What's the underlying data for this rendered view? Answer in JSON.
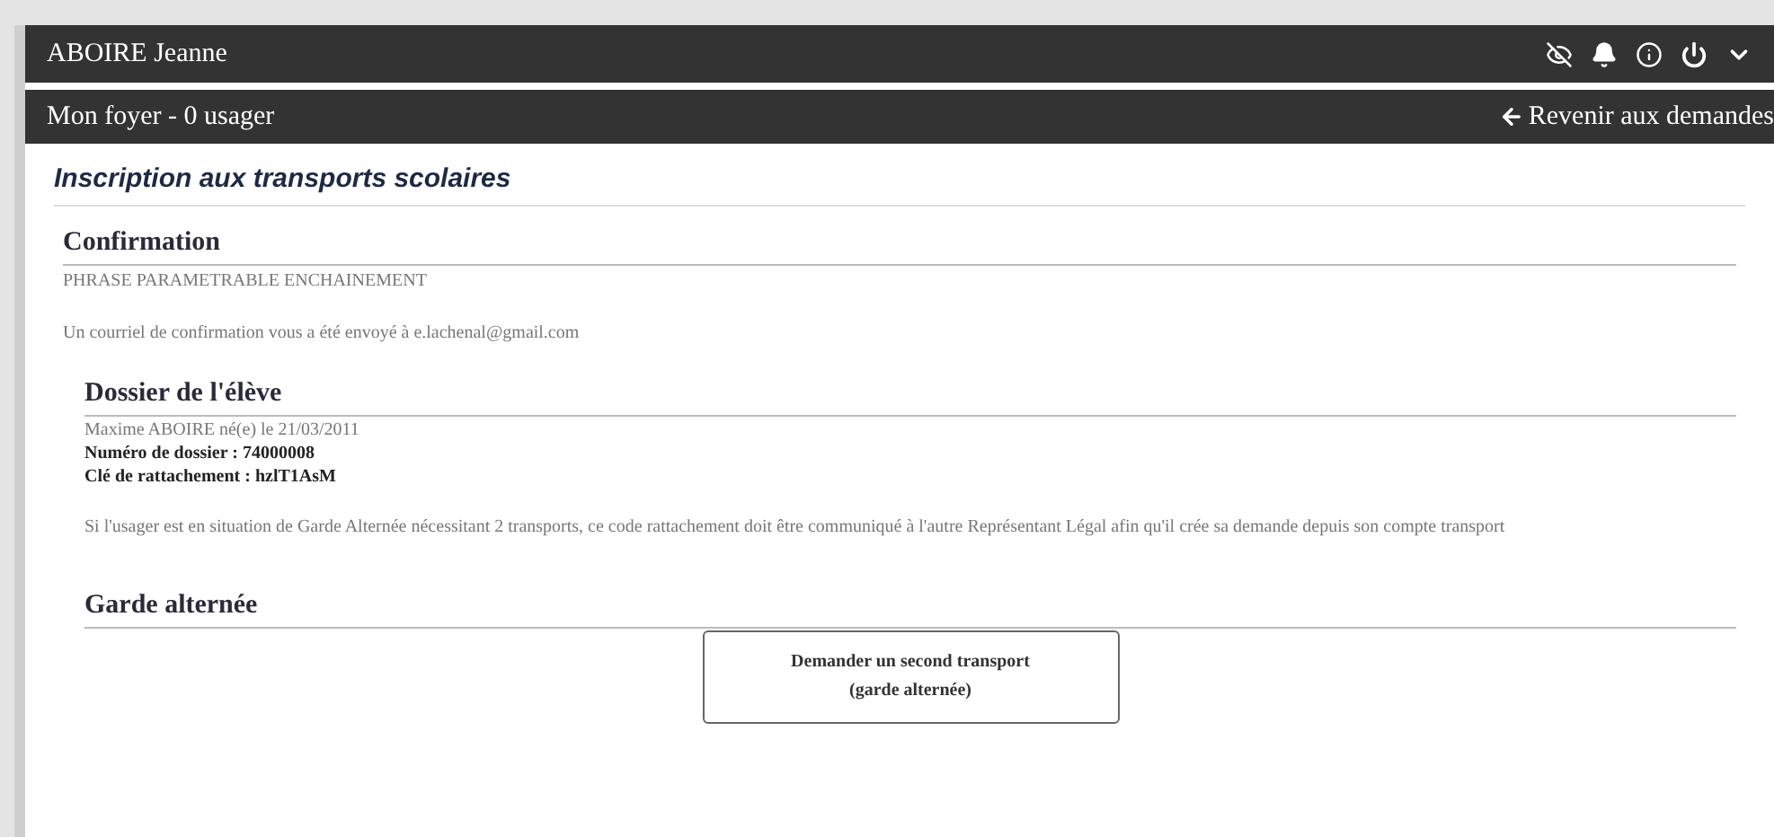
{
  "user_bar": {
    "name": "ABOIRE Jeanne"
  },
  "household_bar": {
    "title": "Mon foyer - 0 usager",
    "back_link": "Revenir aux demandes"
  },
  "page_title": "Inscription aux transports scolaires",
  "confirmation": {
    "heading": "Confirmation",
    "phrase": "PHRASE PARAMETRABLE ENCHAINEMENT",
    "message": "Un courriel de confirmation vous a été envoyé à e.lachenal@gmail.com"
  },
  "student_file": {
    "heading": "Dossier de l'élève",
    "student": "Maxime ABOIRE né(e) le 21/03/2011",
    "file_number": "Numéro de dossier : 74000008",
    "key": "Clé de rattachement : hzlT1AsM",
    "note": "Si l'usager est en situation de Garde Alternée nécessitant 2 transports, ce code rattachement doit être communiqué à l'autre Représentant Légal afin qu'il crée sa demande depuis son compte transport"
  },
  "shared_custody": {
    "heading": "Garde alternée",
    "button_lines": [
      "Demander un second transport",
      "(garde alternée)"
    ]
  }
}
